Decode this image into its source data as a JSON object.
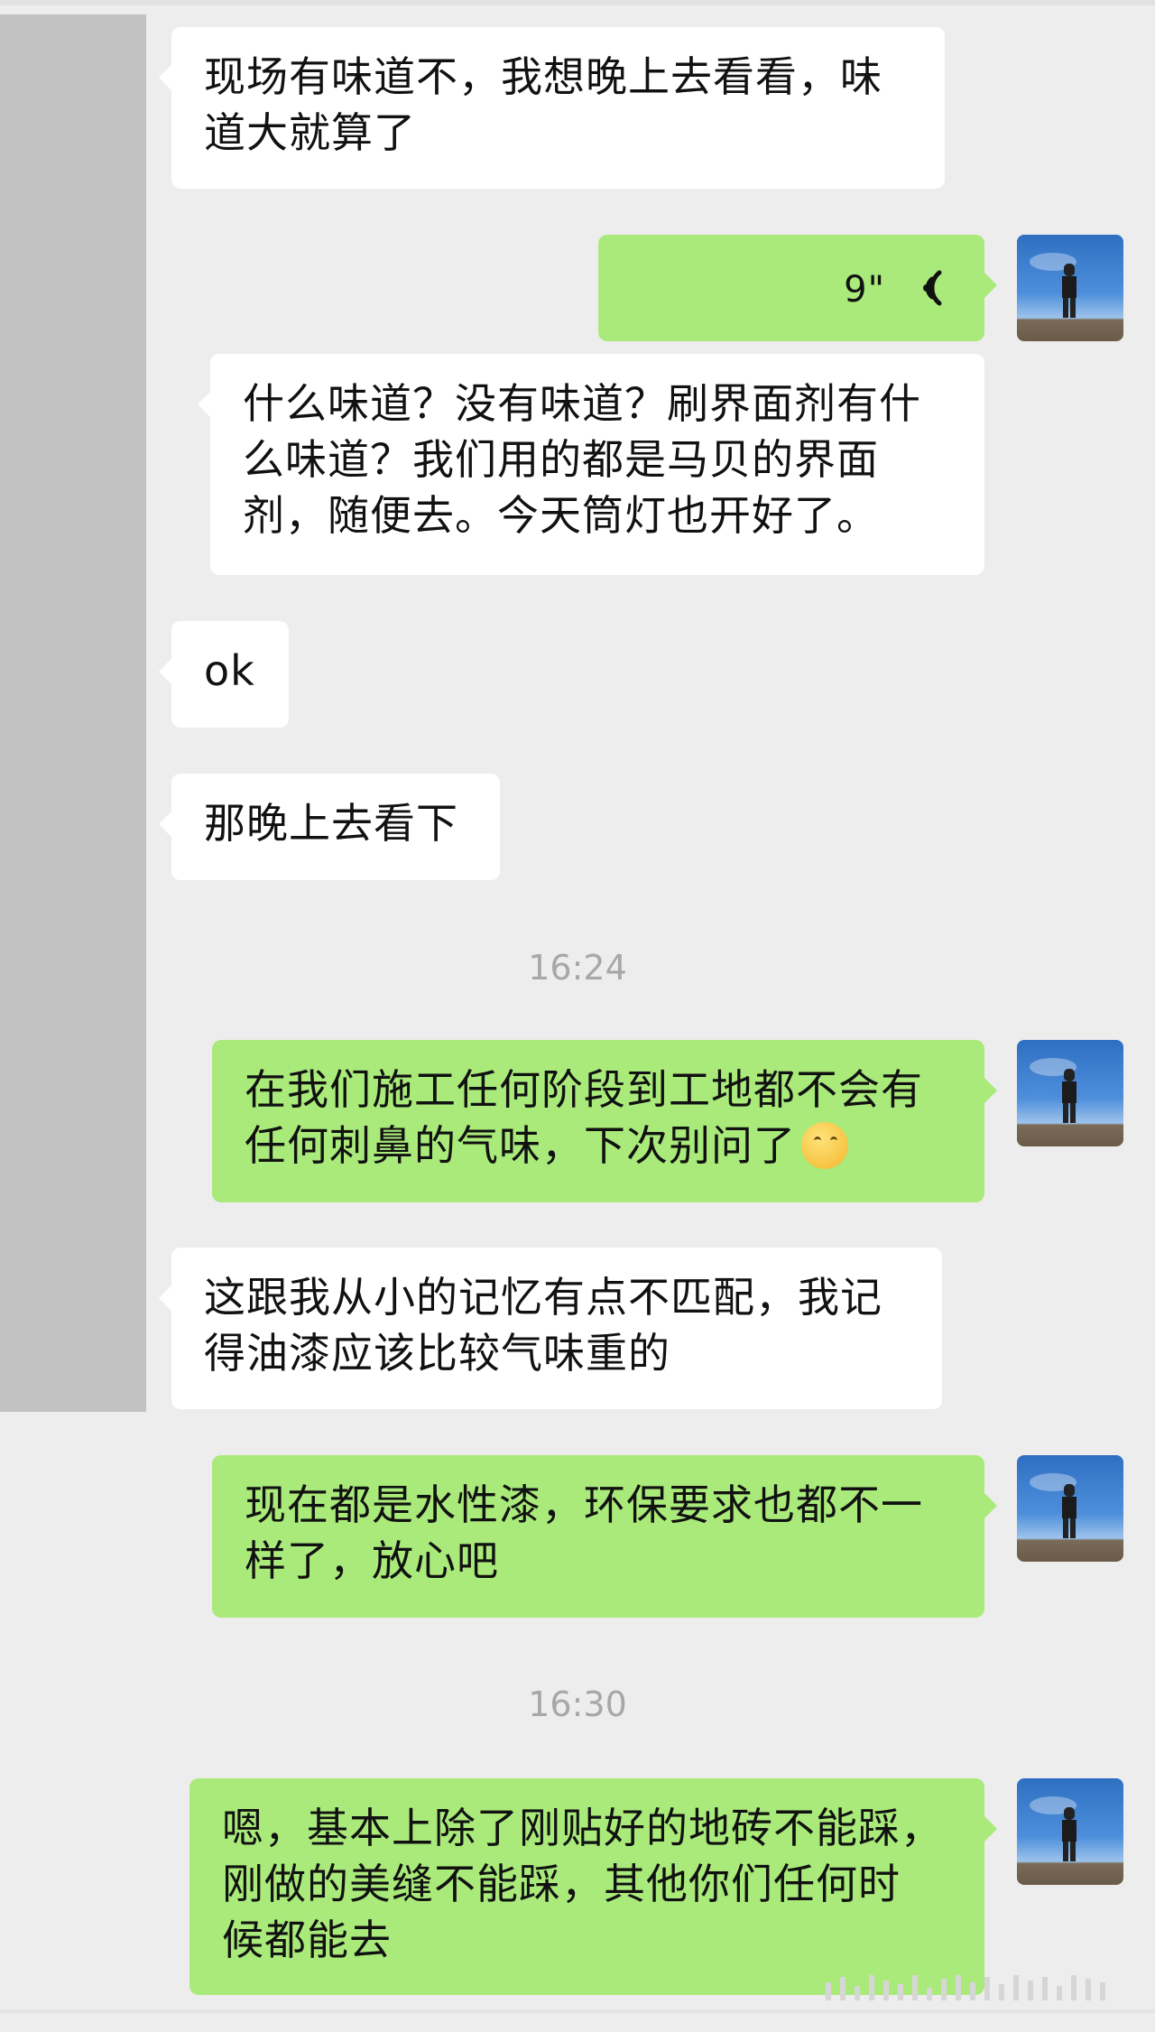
{
  "messages": [
    {
      "side": "in",
      "text": "现场有味道不，我想晚上去看看，味\n道大就算了"
    },
    {
      "side": "out",
      "type": "voice",
      "duration": "9\""
    },
    {
      "side": "in",
      "text": "什么味道？没有味道？刷界面剂有什\n么味道？我们用的都是马贝的界面\n剂，随便去。今天筒灯也开好了。"
    },
    {
      "side": "in",
      "text": "ok"
    },
    {
      "side": "in",
      "text": "那晚上去看下"
    },
    {
      "side": "out",
      "text": "在我们施工任何阶段到工地都不会有\n任何刺鼻的气味，下次别问了",
      "emoji": "thinking-face-icon"
    },
    {
      "side": "in",
      "text": "这跟我从小的记忆有点不匹配，我记\n得油漆应该比较气味重的"
    },
    {
      "side": "out",
      "text": "现在都是水性漆，环保要求也都不一\n样了，放心吧"
    },
    {
      "side": "out",
      "text": "嗯，基本上除了刚贴好的地砖不能踩，\n刚做的美缝不能踩，其他你们任何时\n候都能去"
    }
  ],
  "timestamps": [
    "16:24",
    "16:30"
  ],
  "colors": {
    "outgoing": "#a9ea7a",
    "incoming": "#ffffff",
    "background": "#ededed"
  }
}
